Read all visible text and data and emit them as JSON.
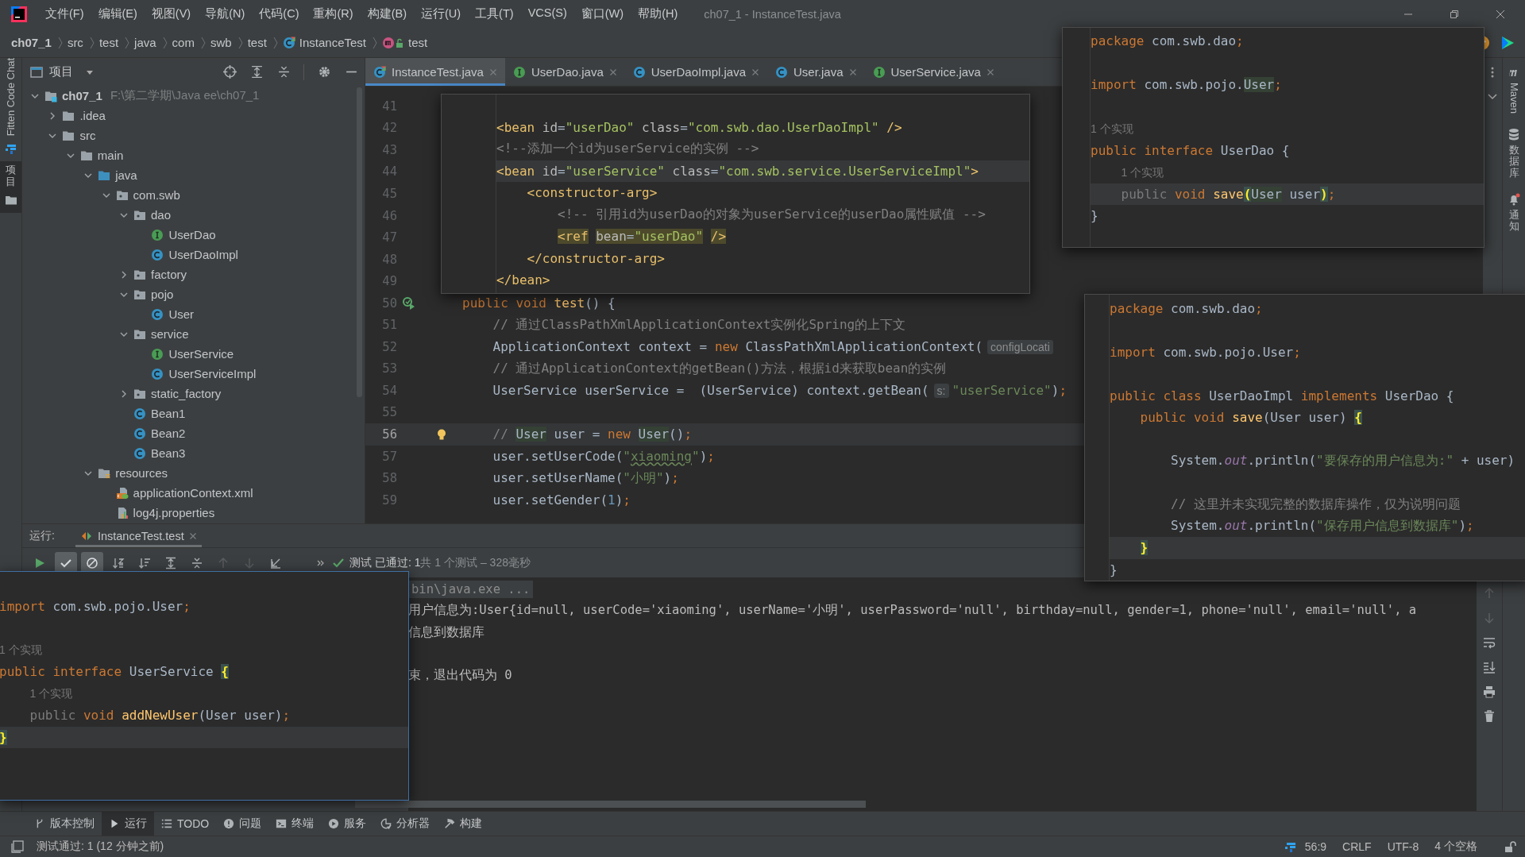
{
  "window": {
    "title": "ch07_1 - InstanceTest.java"
  },
  "menu": [
    "文件(F)",
    "编辑(E)",
    "视图(V)",
    "导航(N)",
    "代码(C)",
    "重构(R)",
    "构建(B)",
    "运行(U)",
    "工具(T)",
    "VCS(S)",
    "窗口(W)",
    "帮助(H)"
  ],
  "breadcrumb": [
    {
      "label": "ch07_1",
      "kind": "project"
    },
    {
      "label": "src",
      "kind": "folder"
    },
    {
      "label": "test",
      "kind": "folder"
    },
    {
      "label": "java",
      "kind": "folder"
    },
    {
      "label": "com",
      "kind": "folder"
    },
    {
      "label": "swb",
      "kind": "folder"
    },
    {
      "label": "test",
      "kind": "folder"
    },
    {
      "label": "InstanceTest",
      "kind": "class"
    },
    {
      "label": "test",
      "kind": "method"
    }
  ],
  "left_strip": [
    {
      "label": "Fitten Code Chat",
      "kind": "fitten",
      "selected": false
    },
    {
      "label": "项目",
      "kind": "project",
      "selected": true
    }
  ],
  "right_strip": [
    {
      "label": "Maven",
      "kind": "maven"
    },
    {
      "label": "数据库",
      "kind": "database"
    },
    {
      "label": "通知",
      "kind": "notifications"
    }
  ],
  "project_panel": {
    "title": "项目",
    "tree": [
      {
        "name": "ch07_1",
        "kind": "project",
        "path": "F:\\第二学期\\Java ee\\ch07_1",
        "expanded": true,
        "children": [
          {
            "name": ".idea",
            "kind": "folder",
            "expanded": false
          },
          {
            "name": "src",
            "kind": "folder",
            "expanded": true,
            "children": [
              {
                "name": "main",
                "kind": "folder",
                "expanded": true,
                "children": [
                  {
                    "name": "java",
                    "kind": "source",
                    "expanded": true,
                    "children": [
                      {
                        "name": "com.swb",
                        "kind": "package",
                        "expanded": true,
                        "children": [
                          {
                            "name": "dao",
                            "kind": "package",
                            "expanded": true,
                            "children": [
                              {
                                "name": "UserDao",
                                "kind": "interface"
                              },
                              {
                                "name": "UserDaoImpl",
                                "kind": "class"
                              }
                            ]
                          },
                          {
                            "name": "factory",
                            "kind": "package",
                            "expanded": false
                          },
                          {
                            "name": "pojo",
                            "kind": "package",
                            "expanded": true,
                            "children": [
                              {
                                "name": "User",
                                "kind": "class"
                              }
                            ]
                          },
                          {
                            "name": "service",
                            "kind": "package",
                            "expanded": true,
                            "children": [
                              {
                                "name": "UserService",
                                "kind": "interface"
                              },
                              {
                                "name": "UserServiceImpl",
                                "kind": "class"
                              }
                            ]
                          },
                          {
                            "name": "static_factory",
                            "kind": "package",
                            "expanded": false
                          },
                          {
                            "name": "Bean1",
                            "kind": "class"
                          },
                          {
                            "name": "Bean2",
                            "kind": "class"
                          },
                          {
                            "name": "Bean3",
                            "kind": "class"
                          }
                        ]
                      }
                    ]
                  },
                  {
                    "name": "resources",
                    "kind": "resources",
                    "expanded": true,
                    "children": [
                      {
                        "name": "applicationContext.xml",
                        "kind": "xml"
                      },
                      {
                        "name": "log4j.properties",
                        "kind": "properties"
                      }
                    ]
                  }
                ]
              }
            ]
          }
        ]
      }
    ]
  },
  "editor": {
    "tabs": [
      {
        "label": "InstanceTest.java",
        "kind": "test-class",
        "selected": true
      },
      {
        "label": "UserDao.java",
        "kind": "interface",
        "selected": false
      },
      {
        "label": "UserDaoImpl.java",
        "kind": "class",
        "selected": false
      },
      {
        "label": "User.java",
        "kind": "class",
        "selected": false
      },
      {
        "label": "UserService.java",
        "kind": "interface",
        "selected": false
      }
    ],
    "lines": [
      {
        "number": "41",
        "kind": "blank",
        "current": false
      },
      {
        "number": "42",
        "kind": "blank",
        "current": false
      },
      {
        "number": "43",
        "kind": "blank",
        "current": false
      },
      {
        "number": "44",
        "kind": "blank",
        "current": false
      },
      {
        "number": "45",
        "kind": "blank",
        "current": false
      },
      {
        "number": "46",
        "kind": "blank",
        "current": false
      },
      {
        "number": "47",
        "kind": "blank",
        "current": false
      },
      {
        "number": "48",
        "kind": "blank",
        "current": false
      },
      {
        "number": "49",
        "kind": "blank",
        "current": false
      },
      {
        "number": "50",
        "kind": "code",
        "current": false,
        "gutter": {
          "kind": "run"
        },
        "tokens": [
          {
            "text": "public void",
            "kind": "kw"
          },
          {
            "text": " test",
            "kind": "fn"
          },
          {
            "text": "() {",
            "kind": "plain"
          }
        ]
      },
      {
        "number": "51",
        "kind": "code",
        "current": false,
        "tokens": [
          {
            "text": "    // 通过ClassPathXmlApplicationContext实例化Spring的上下文",
            "kind": "cmt"
          }
        ]
      },
      {
        "number": "52",
        "kind": "code",
        "current": false,
        "tokens": [
          {
            "text": "    ApplicationContext context = ",
            "kind": "plain"
          },
          {
            "text": "new",
            "kind": "kw"
          },
          {
            "text": " ClassPathXmlApplicationContext(",
            "kind": "plain"
          },
          {
            "text": "configLocati",
            "kind": "hint"
          }
        ]
      },
      {
        "number": "53",
        "kind": "code",
        "current": false,
        "tokens": [
          {
            "text": "    // 通过ApplicationContext的getBean()方法，根据id来获取bean的实例",
            "kind": "cmt"
          }
        ]
      },
      {
        "number": "54",
        "kind": "code",
        "current": false,
        "tokens": [
          {
            "text": "    UserService userService =  (UserService) context.getBean(",
            "kind": "plain"
          },
          {
            "text": "s:",
            "kind": "hint"
          },
          {
            "text": "\"userService\"",
            "kind": "str"
          },
          {
            "text": ")",
            "kind": "plain"
          },
          {
            "text": ";",
            "kind": "kw"
          }
        ]
      },
      {
        "number": "55",
        "kind": "blank",
        "current": false
      },
      {
        "number": "56",
        "kind": "code",
        "current": true,
        "gutter": {
          "kind": "bulb"
        },
        "tokens": [
          {
            "text": "    // ",
            "kind": "cmt"
          },
          {
            "text": "User",
            "kind": "usage"
          },
          {
            "text": " user = ",
            "kind": "plain"
          },
          {
            "text": "new ",
            "kind": "kw"
          },
          {
            "text": "User",
            "kind": "usage"
          },
          {
            "text": "()",
            "kind": "plain"
          },
          {
            "text": ";",
            "kind": "kw"
          }
        ]
      },
      {
        "number": "57",
        "kind": "code",
        "current": false,
        "tokens": [
          {
            "text": "    user.setUserCode(",
            "kind": "plain"
          },
          {
            "text": "\"",
            "kind": "str"
          },
          {
            "text": "xiaoming",
            "kind": "typo"
          },
          {
            "text": "\"",
            "kind": "str"
          },
          {
            "text": ")",
            "kind": "plain"
          },
          {
            "text": ";",
            "kind": "kw"
          }
        ]
      },
      {
        "number": "58",
        "kind": "code",
        "current": false,
        "tokens": [
          {
            "text": "    user.setUserName(",
            "kind": "plain"
          },
          {
            "text": "\"小明\"",
            "kind": "str"
          },
          {
            "text": ")",
            "kind": "plain"
          },
          {
            "text": ";",
            "kind": "kw"
          }
        ]
      },
      {
        "number": "59",
        "kind": "code",
        "current": false,
        "tokens": [
          {
            "text": "    user.setGender(",
            "kind": "plain"
          },
          {
            "text": "1",
            "kind": "num"
          },
          {
            "text": ")",
            "kind": "plain"
          },
          {
            "text": ";",
            "kind": "kw"
          }
        ]
      }
    ]
  },
  "peek_xml": {
    "lines": [
      {
        "kind": "blank",
        "current": false
      },
      {
        "kind": "code",
        "current": false,
        "tokens": [
          {
            "text": "<bean",
            "kind": "tag"
          },
          {
            "text": " id",
            "kind": "attr"
          },
          {
            "text": "=",
            "kind": "plain"
          },
          {
            "text": "\"userDao\"",
            "kind": "val"
          },
          {
            "text": " class",
            "kind": "attr"
          },
          {
            "text": "=",
            "kind": "plain"
          },
          {
            "text": "\"com.swb.dao.UserDaoImpl\"",
            "kind": "val"
          },
          {
            "text": " />",
            "kind": "tag"
          }
        ]
      },
      {
        "kind": "code",
        "current": false,
        "tokens": [
          {
            "text": "<!--添加一个id为userService的实例 -->",
            "kind": "cmt"
          }
        ]
      },
      {
        "kind": "code",
        "current": true,
        "tokens": [
          {
            "text": "<bean",
            "kind": "tag"
          },
          {
            "text": " id",
            "kind": "attr"
          },
          {
            "text": "=",
            "kind": "plain"
          },
          {
            "text": "\"userService\"",
            "kind": "val"
          },
          {
            "text": " class",
            "kind": "attr"
          },
          {
            "text": "=",
            "kind": "plain"
          },
          {
            "text": "\"com.swb.service.UserServiceImpl\"",
            "kind": "val"
          },
          {
            "text": ">",
            "kind": "tag"
          }
        ]
      },
      {
        "kind": "code",
        "current": false,
        "tokens": [
          {
            "text": "    <constructor-arg>",
            "kind": "tag"
          }
        ]
      },
      {
        "kind": "code",
        "current": false,
        "tokens": [
          {
            "text": "        <!-- 引用id为userDao的对象为userService的userDao属性赋值 -->",
            "kind": "cmt"
          }
        ]
      },
      {
        "kind": "code",
        "current": false,
        "tokens": [
          {
            "text": "        <ref",
            "kind": "taghl"
          },
          {
            "text": " bean",
            "kind": "attrhl"
          },
          {
            "text": "=",
            "kind": "plainhl"
          },
          {
            "text": "\"userDao\"",
            "kind": "valhl"
          },
          {
            "text": " />",
            "kind": "taghl"
          }
        ]
      },
      {
        "kind": "code",
        "current": false,
        "tokens": [
          {
            "text": "    </constructor-arg>",
            "kind": "tag"
          }
        ]
      },
      {
        "kind": "code",
        "current": false,
        "tokens": [
          {
            "text": "</bean>",
            "kind": "tag"
          }
        ]
      }
    ]
  },
  "peek_user_dao": {
    "lines": [
      {
        "kind": "code",
        "current": false,
        "tokens": [
          {
            "text": "package",
            "kind": "kw"
          },
          {
            "text": " com.swb.dao",
            "kind": "plain"
          },
          {
            "text": ";",
            "kind": "kw"
          }
        ]
      },
      {
        "kind": "blank",
        "current": false
      },
      {
        "kind": "code",
        "current": false,
        "tokens": [
          {
            "text": "import",
            "kind": "kw"
          },
          {
            "text": " com.swb.pojo.",
            "kind": "plain"
          },
          {
            "text": "User",
            "kind": "usage"
          },
          {
            "text": ";",
            "kind": "kw"
          }
        ]
      },
      {
        "kind": "blank",
        "current": false
      },
      {
        "kind": "code",
        "current": false,
        "tokens": [
          {
            "text": "1 个实现",
            "kind": "lens"
          }
        ]
      },
      {
        "kind": "code",
        "current": false,
        "tokens": [
          {
            "text": "public interface",
            "kind": "kw"
          },
          {
            "text": " UserDao {",
            "kind": "plain"
          }
        ]
      },
      {
        "kind": "code",
        "current": false,
        "tokens": [
          {
            "text": "    1 个实现",
            "kind": "lens"
          }
        ]
      },
      {
        "kind": "code",
        "current": true,
        "tokens": [
          {
            "text": "    public",
            "kind": "dim"
          },
          {
            "text": " void",
            "kind": "kw"
          },
          {
            "text": " save",
            "kind": "fn"
          },
          {
            "text": "(",
            "kind": "brace"
          },
          {
            "text": "User",
            "kind": "usage"
          },
          {
            "text": " user",
            "kind": "plain"
          },
          {
            "text": ")",
            "kind": "brace"
          },
          {
            "text": ";",
            "kind": "kw"
          }
        ]
      },
      {
        "kind": "code",
        "current": false,
        "tokens": [
          {
            "text": "}",
            "kind": "plain"
          }
        ]
      }
    ]
  },
  "peek_user_dao_impl": {
    "lines": [
      {
        "kind": "code",
        "current": false,
        "tokens": [
          {
            "text": "package",
            "kind": "kw"
          },
          {
            "text": " com.swb.dao",
            "kind": "plain"
          },
          {
            "text": ";",
            "kind": "kw"
          }
        ]
      },
      {
        "kind": "blank",
        "current": false
      },
      {
        "kind": "code",
        "current": false,
        "tokens": [
          {
            "text": "import",
            "kind": "kw"
          },
          {
            "text": " com.swb.pojo.User",
            "kind": "plain"
          },
          {
            "text": ";",
            "kind": "kw"
          }
        ]
      },
      {
        "kind": "blank",
        "current": false
      },
      {
        "kind": "code",
        "current": false,
        "tokens": [
          {
            "text": "public class",
            "kind": "kw"
          },
          {
            "text": " UserDaoImpl ",
            "kind": "plain"
          },
          {
            "text": "implements",
            "kind": "kw"
          },
          {
            "text": " UserDao {",
            "kind": "plain"
          }
        ]
      },
      {
        "kind": "code",
        "current": false,
        "tokens": [
          {
            "text": "    public void",
            "kind": "kw"
          },
          {
            "text": " save",
            "kind": "fn"
          },
          {
            "text": "(User user) ",
            "kind": "plain"
          },
          {
            "text": "{",
            "kind": "brace"
          }
        ]
      },
      {
        "kind": "blank",
        "current": false
      },
      {
        "kind": "code",
        "current": false,
        "tokens": [
          {
            "text": "        System.",
            "kind": "plain"
          },
          {
            "text": "out",
            "kind": "field"
          },
          {
            "text": ".println(",
            "kind": "plain"
          },
          {
            "text": "\"要保存的用户信息为:\"",
            "kind": "str"
          },
          {
            "text": " + user)",
            "kind": "plain"
          }
        ]
      },
      {
        "kind": "blank",
        "current": false
      },
      {
        "kind": "code",
        "current": false,
        "tokens": [
          {
            "text": "        // 这里并未实现完整的数据库操作，仅为说明问题",
            "kind": "cmt"
          }
        ]
      },
      {
        "kind": "code",
        "current": false,
        "tokens": [
          {
            "text": "        System.",
            "kind": "plain"
          },
          {
            "text": "out",
            "kind": "field"
          },
          {
            "text": ".println(",
            "kind": "plain"
          },
          {
            "text": "\"保存用户信息到数据库\"",
            "kind": "str"
          },
          {
            "text": ")",
            "kind": "plain"
          },
          {
            "text": ";",
            "kind": "kw"
          }
        ]
      },
      {
        "kind": "code",
        "current": true,
        "tokens": [
          {
            "text": "    }",
            "kind": "brace"
          }
        ]
      },
      {
        "kind": "code",
        "current": false,
        "tokens": [
          {
            "text": "}",
            "kind": "plain"
          }
        ]
      }
    ]
  },
  "peek_user_service": {
    "lines": [
      {
        "kind": "blank",
        "current": false
      },
      {
        "kind": "code",
        "current": false,
        "tokens": [
          {
            "text": "import",
            "kind": "kw"
          },
          {
            "text": " com.swb.pojo.User",
            "kind": "plain"
          },
          {
            "text": ";",
            "kind": "kw"
          }
        ]
      },
      {
        "kind": "blank",
        "current": false
      },
      {
        "kind": "code",
        "current": false,
        "tokens": [
          {
            "text": "1 个实现",
            "kind": "lens"
          }
        ]
      },
      {
        "kind": "code",
        "current": false,
        "tokens": [
          {
            "text": "public interface",
            "kind": "kw"
          },
          {
            "text": " UserService ",
            "kind": "plain"
          },
          {
            "text": "{",
            "kind": "brace"
          }
        ]
      },
      {
        "kind": "code",
        "current": false,
        "tokens": [
          {
            "text": "    1 个实现",
            "kind": "lens"
          }
        ]
      },
      {
        "kind": "code",
        "current": false,
        "tokens": [
          {
            "text": "    public",
            "kind": "dim"
          },
          {
            "text": " void",
            "kind": "kw"
          },
          {
            "text": " addNewUser",
            "kind": "fn"
          },
          {
            "text": "(User user)",
            "kind": "plain"
          },
          {
            "text": ";",
            "kind": "kw"
          }
        ]
      },
      {
        "kind": "code",
        "current": true,
        "tokens": [
          {
            "text": "}",
            "kind": "brace"
          }
        ]
      }
    ]
  },
  "run_panel": {
    "label": "运行:",
    "tab": {
      "label": "InstanceTest.test",
      "selected": true
    },
    "toolbar": [
      {
        "kind": "rerun",
        "selected": false,
        "disabled": false
      },
      {
        "kind": "show-passed",
        "selected": true,
        "disabled": false
      },
      {
        "kind": "show-ignored",
        "selected": true,
        "disabled": false
      },
      {
        "kind": "sort-alpha",
        "selected": false,
        "disabled": false
      },
      {
        "kind": "sort-duration",
        "selected": false,
        "disabled": false
      },
      {
        "kind": "expand-all",
        "selected": false,
        "disabled": false
      },
      {
        "kind": "collapse-all",
        "selected": false,
        "disabled": false
      },
      {
        "kind": "previous",
        "selected": false,
        "disabled": true
      },
      {
        "kind": "next",
        "selected": false,
        "disabled": true
      },
      {
        "kind": "export",
        "selected": false,
        "disabled": false
      }
    ],
    "status": {
      "passed": "测试 已通过: 1",
      "summary": "共 1 个测试 – 328毫秒"
    },
    "console": [
      {
        "kind": "folded",
        "text": "bin\\java.exe ..."
      },
      {
        "kind": "output",
        "text": "用户信息为:User{id=null, userCode='xiaoming', userName='小明', userPassword='null', birthday=null, gender=1, phone='null', email='null', a"
      },
      {
        "kind": "output",
        "text": "信息到数据库"
      },
      {
        "kind": "blank"
      },
      {
        "kind": "output",
        "text": "束，退出代码为 0"
      }
    ]
  },
  "bottom_tabs": [
    {
      "label": "版本控制",
      "kind": "vcs",
      "selected": false
    },
    {
      "label": "运行",
      "kind": "run",
      "selected": true
    },
    {
      "label": "TODO",
      "kind": "todo",
      "selected": false
    },
    {
      "label": "问题",
      "kind": "problems",
      "selected": false
    },
    {
      "label": "终端",
      "kind": "terminal",
      "selected": false
    },
    {
      "label": "服务",
      "kind": "services",
      "selected": false
    },
    {
      "label": "分析器",
      "kind": "profiler",
      "selected": false
    },
    {
      "label": "构建",
      "kind": "build",
      "selected": false
    }
  ],
  "status_bar": {
    "message": "测试通过: 1 (12 分钟之前)",
    "position": "56:9",
    "line_ending": "CRLF",
    "encoding": "UTF-8",
    "indent": "4 个空格"
  }
}
